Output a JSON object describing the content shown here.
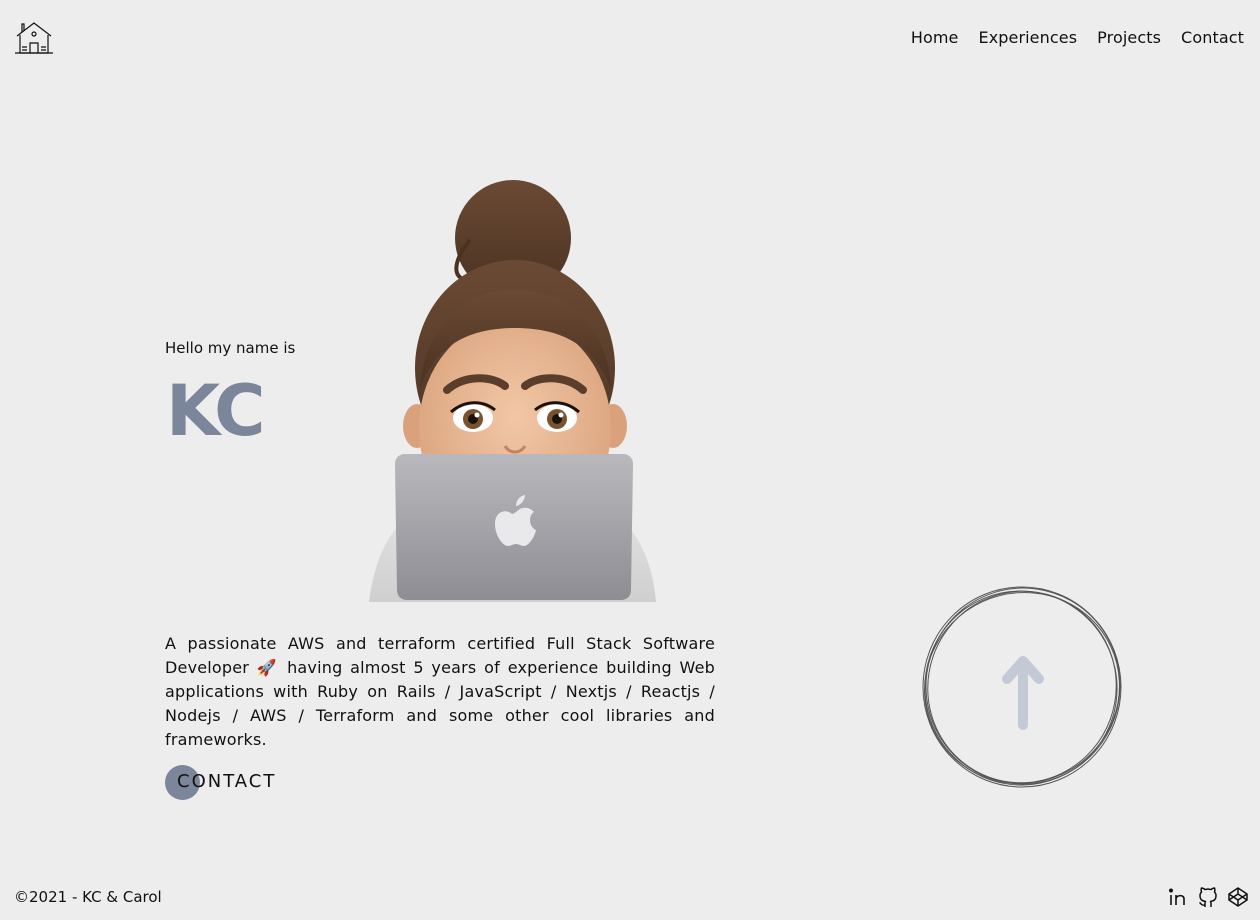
{
  "header": {
    "logo_icon": "house-icon",
    "nav": [
      {
        "label": "Home"
      },
      {
        "label": "Experiences"
      },
      {
        "label": "Projects"
      },
      {
        "label": "Contact"
      }
    ]
  },
  "hero": {
    "greeting": "Hello my name is",
    "name": "KC",
    "description": "A passionate AWS and terraform certified Full Stack Software Developer 🚀 having almost 5 years of experience building Web applications with Ruby on Rails / JavaScript / Nextjs / Reactjs / Nodejs / AWS / Terraform and some other cool libraries and frameworks.",
    "contact_label": "CONTACT",
    "avatar_icon": "memoji-laptop-avatar"
  },
  "scroll_top": {
    "icon": "arrow-up-icon"
  },
  "footer": {
    "copyright": "©2021 - KC & Carol",
    "socials": [
      {
        "icon": "linkedin-icon"
      },
      {
        "icon": "github-icon"
      },
      {
        "icon": "codepen-icon"
      }
    ]
  },
  "colors": {
    "background": "#ededed",
    "accent": "#7c869a",
    "text": "#111111"
  }
}
